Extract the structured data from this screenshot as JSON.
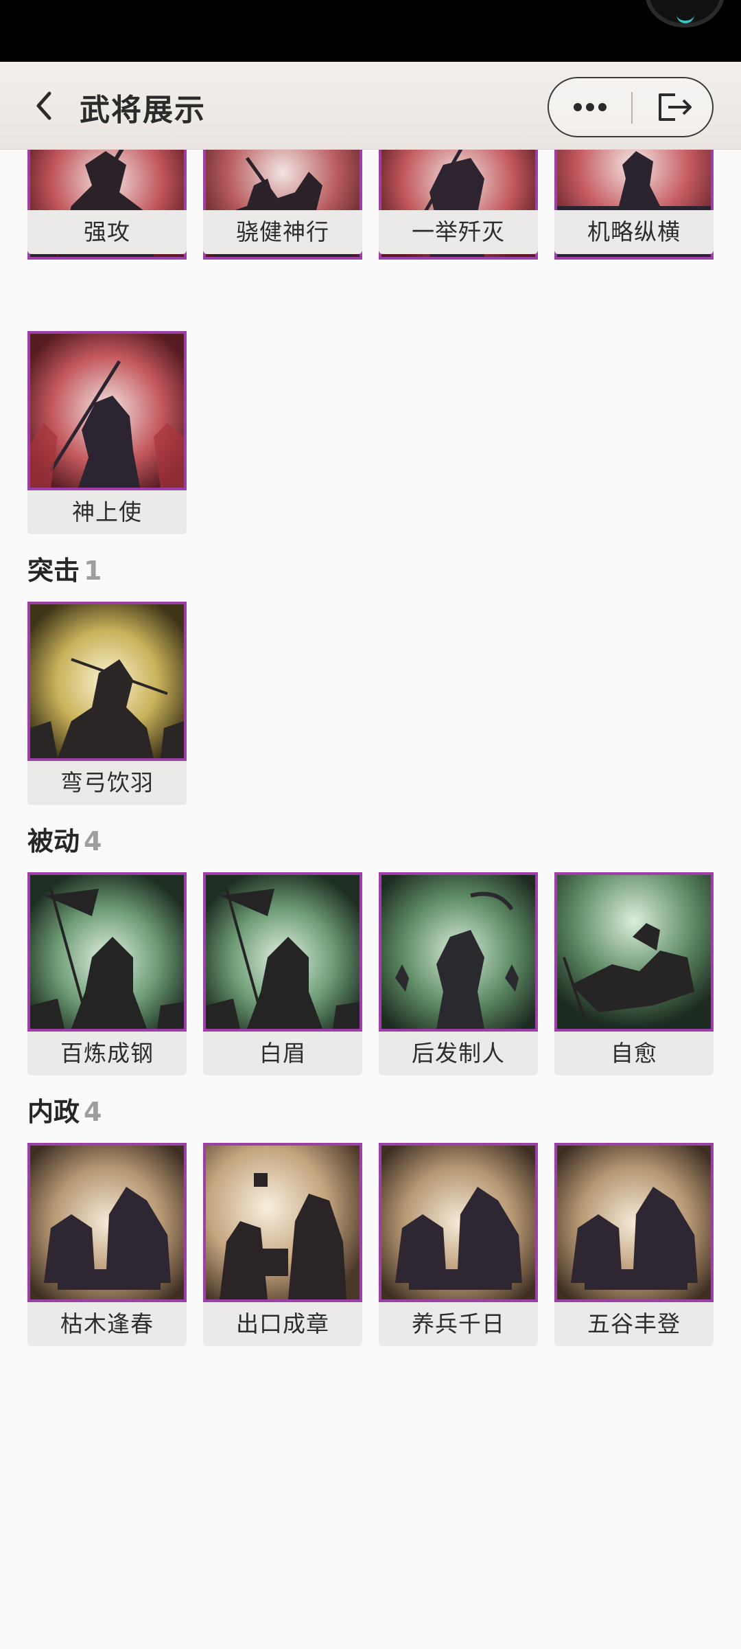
{
  "header": {
    "title": "武将展示"
  },
  "top_row": {
    "labels": [
      "强攻",
      "骁健神行",
      "一举歼灭",
      "机略纵横"
    ]
  },
  "row_two": {
    "labels": [
      "神上使"
    ]
  },
  "sections": [
    {
      "name": "突击",
      "count": "1",
      "labels": [
        "弯弓饮羽"
      ]
    },
    {
      "name": "被动",
      "count": "4",
      "labels": [
        "百炼成钢",
        "白眉",
        "后发制人",
        "自愈"
      ]
    },
    {
      "name": "内政",
      "count": "4",
      "labels": [
        "枯木逢春",
        "出口成章",
        "养兵千日",
        "五谷丰登"
      ]
    }
  ],
  "icons": {
    "back": "chevron-left-icon",
    "more": "more-dots-icon",
    "exit": "exit-icon"
  },
  "colors": {
    "card_border": "#9c3fa6",
    "label_bg": "#ece9e9",
    "count_gray": "#9e9e9e"
  }
}
